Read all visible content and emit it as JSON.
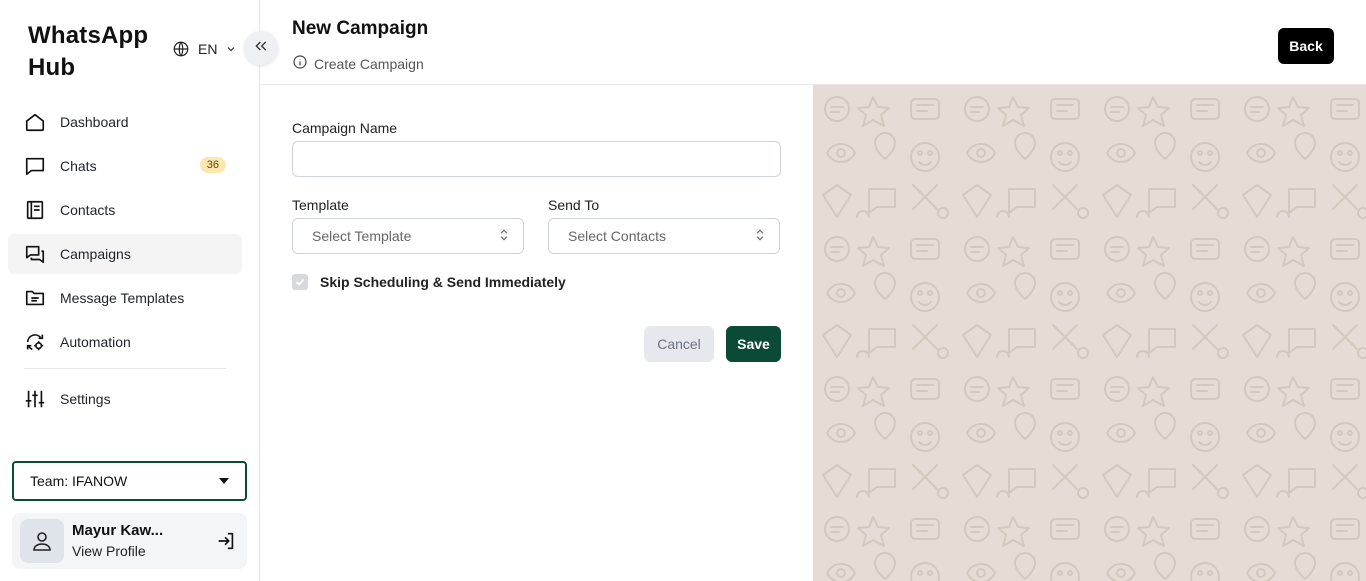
{
  "app": {
    "title": "WhatsApp Hub"
  },
  "language": {
    "code": "EN"
  },
  "sidebar": {
    "items": [
      {
        "label": "Dashboard",
        "icon": "home-icon"
      },
      {
        "label": "Chats",
        "icon": "chat-icon",
        "badge": "36"
      },
      {
        "label": "Contacts",
        "icon": "contacts-icon"
      },
      {
        "label": "Campaigns",
        "icon": "campaigns-icon",
        "active": true
      },
      {
        "label": "Message Templates",
        "icon": "folder-icon"
      },
      {
        "label": "Automation",
        "icon": "automation-icon"
      },
      {
        "label": "Settings",
        "icon": "sliders-icon"
      }
    ]
  },
  "team": {
    "label": "Team: IFANOW"
  },
  "profile": {
    "name": "Mayur Kaw...",
    "link": "View Profile"
  },
  "header": {
    "title": "New Campaign",
    "subtitle": "Create Campaign",
    "back_label": "Back"
  },
  "form": {
    "campaign_name_label": "Campaign Name",
    "campaign_name_value": "",
    "template_label": "Template",
    "template_placeholder": "Select Template",
    "send_to_label": "Send To",
    "send_to_placeholder": "Select Contacts",
    "skip_scheduling_label": "Skip Scheduling & Send Immediately",
    "skip_scheduling_checked": true,
    "cancel_label": "Cancel",
    "save_label": "Save"
  },
  "colors": {
    "primary": "#0b4a36",
    "badge_bg": "#fde7b0",
    "preview_bg": "#e5ddd5"
  }
}
